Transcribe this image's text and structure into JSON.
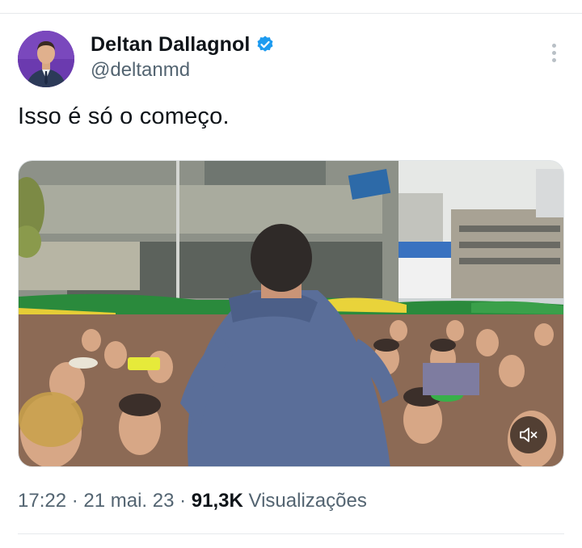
{
  "author": {
    "display_name": "Deltan Dallagnol",
    "handle": "@deltanmd",
    "verified": true,
    "verified_color": "#1d9bf0",
    "avatar_icon": "profile-photo"
  },
  "tweet": {
    "text": "Isso é só o começo."
  },
  "media": {
    "type": "video",
    "mute_icon": "speaker-muted-icon"
  },
  "meta": {
    "time": "17:22",
    "separator": " · ",
    "date": "21 mai. 23",
    "views_count": "91,3K",
    "views_label": "Visualizações"
  },
  "more_icon": "vertical-ellipsis-icon"
}
